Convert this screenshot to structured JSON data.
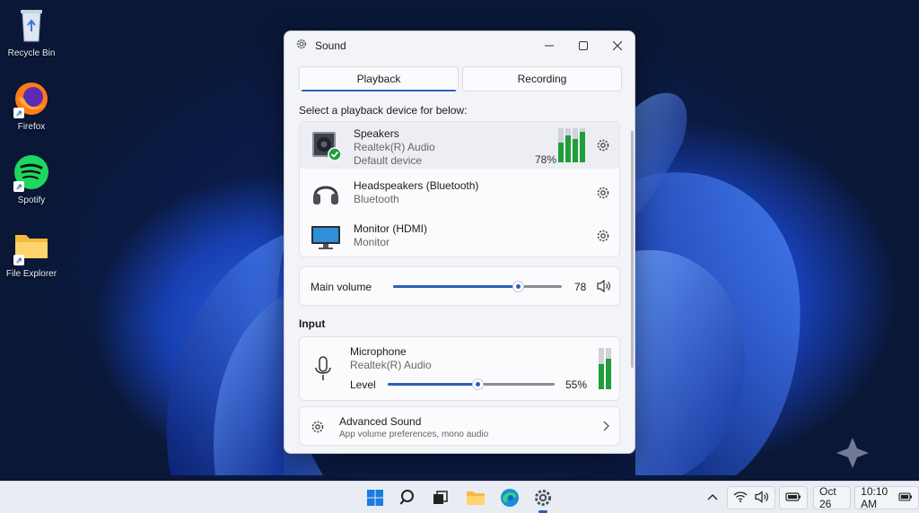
{
  "desktop": {
    "icons": [
      {
        "label": "Recycle Bin",
        "icon": "recycle-bin-icon"
      },
      {
        "label": "Firefox",
        "icon": "firefox-icon"
      },
      {
        "label": "Spotify",
        "icon": "spotify-icon"
      },
      {
        "label": "File Explorer",
        "icon": "folder-icon"
      }
    ]
  },
  "window": {
    "title": "Sound",
    "tabs": [
      {
        "label": "Playback",
        "active": true
      },
      {
        "label": "Recording",
        "active": false
      }
    ],
    "playback_prompt": "Select a playback device for below:",
    "devices": [
      {
        "name": "Speakers",
        "sub1": "Realtek(R) Audio",
        "sub2": "Default device",
        "level": "78%",
        "level_value": 0.78,
        "selected": true,
        "icon": "speaker-icon"
      },
      {
        "name": "Headspeakers (Bluetooth)",
        "sub1": "Bluetooth",
        "selected": false,
        "icon": "headphones-icon"
      },
      {
        "name": "Monitor (HDMI)",
        "sub1": "Monitor",
        "selected": false,
        "icon": "monitor-icon"
      }
    ],
    "main_volume": {
      "label": "Main volume",
      "value": "78",
      "fraction": 0.78
    },
    "input_heading": "Input",
    "microphone": {
      "name": "Microphone",
      "sub": "Realtek(R) Audio",
      "level_label": "Level",
      "level": "55%",
      "fraction": 0.55
    },
    "advanced": {
      "title": "Advanced Sound",
      "sub": "App volume preferences, mono audio"
    }
  },
  "taskbar": {
    "date": "Oct 26",
    "time": "10:10 AM",
    "pinned": [
      "windows-start-icon",
      "search-icon",
      "task-view-icon",
      "file-explorer-icon",
      "edge-icon",
      "settings-icon"
    ]
  },
  "colors": {
    "accent": "#2b5fb8",
    "meter_green": "#1f9e3a",
    "window_bg": "#f3f4f8"
  }
}
